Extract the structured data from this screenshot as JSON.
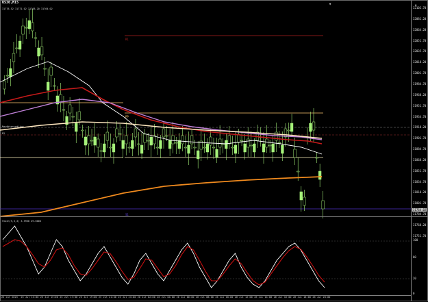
{
  "window": {
    "title": "US30,M15",
    "ohlc_text": "31778.52 31771.02 31768.20 31764.02"
  },
  "colors": {
    "background": "#000000",
    "bull_candle": "#a6f27a",
    "bear_candle": "#000000",
    "ma_fast": "#ffffff",
    "ma_red": "#c41a1a",
    "ma_violet": "#c080d8",
    "ma_cream": "#ffe8c0",
    "ma_orange": "#f08a1e",
    "pivot_line": "#ffc870",
    "s1_line": "#5030c8",
    "r1_line": "#b02020",
    "stoch_main": "#ffffff",
    "stoch_signal": "#c81010"
  },
  "price_axis": {
    "labels": [
      "32102.70",
      "32081.20",
      "32064.20",
      "32051.70",
      "32035.70",
      "32018.20",
      "32001.70",
      "31984.70",
      "31968.20",
      "31951.70",
      "31934.70",
      "31918.20",
      "31901.70",
      "31884.70",
      "31868.20",
      "31851.70",
      "31834.70",
      "31818.20",
      "31801.70",
      "31784.70",
      "31768.20",
      "31751.70"
    ],
    "current_price": "31764.02"
  },
  "levels": {
    "r1_label": "R1",
    "s1_label": "S1",
    "pivot_label": "PP",
    "left_labels": [
      "NewAdvancedLine",
      "R2"
    ]
  },
  "oscillator": {
    "title": "Stoch(9,3,3) 3.5938 49.6000",
    "levels": [
      "100",
      "80",
      "20",
      "0"
    ]
  },
  "time_axis": {
    "labels": [
      "25 Jul 2023",
      "25 Jul 13:00",
      "25 Jul 15:00",
      "25 Jul 17:00",
      "25 Jul 19:00",
      "25 Jul 21:00",
      "25 Jul 23:00",
      "26 Jul 02:00",
      "26 Jul 04:00",
      "26 Jul 06:00",
      "26 Jul 08:00",
      "26 Jul 10:00",
      "26 Jul 12:00",
      "26 Jul 14:00",
      "26 Jul 16:00",
      "26 Jul 18:00",
      "26 Jul 20:00"
    ]
  }
}
